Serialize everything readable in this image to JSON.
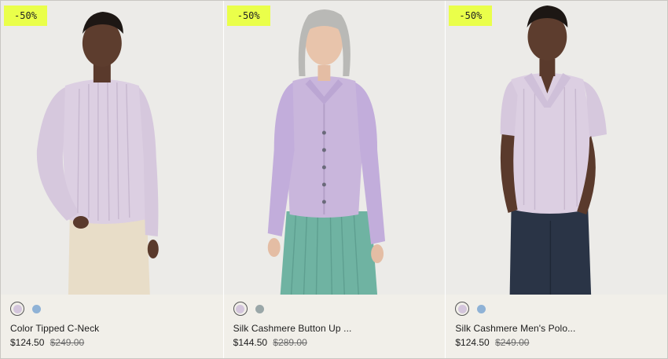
{
  "products": [
    {
      "badge": "-50%",
      "name": "Color Tipped C-Neck",
      "price": "$124.50",
      "original_price": "$249.00",
      "swatches": [
        "#d4c6dc",
        "#8fb2d6"
      ],
      "selected_swatch": 0
    },
    {
      "badge": "-50%",
      "name": "Silk Cashmere Button Up ...",
      "price": "$144.50",
      "original_price": "$289.00",
      "swatches": [
        "#d4c6dc",
        "#9aa7a8"
      ],
      "selected_swatch": 0
    },
    {
      "badge": "-50%",
      "name": "Silk Cashmere Men's Polo...",
      "price": "$124.50",
      "original_price": "$249.00",
      "swatches": [
        "#d4c6dc",
        "#8fb2d6"
      ],
      "selected_swatch": 0
    }
  ],
  "colors": {
    "badge_bg": "#eaff4a",
    "lavender": "#d6c8df",
    "page_bg": "#f1efe9"
  }
}
